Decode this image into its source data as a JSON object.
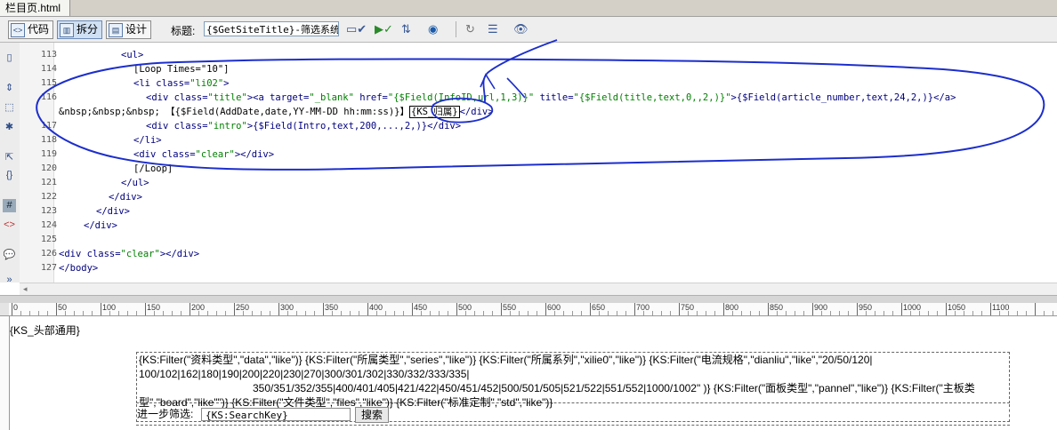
{
  "document": {
    "tab_title": "栏目页.html"
  },
  "toolbar": {
    "code_label": "代码",
    "split_label": "拆分",
    "design_label": "设计",
    "title_label": "标题:",
    "title_value": "{$GetSiteTitle}-筛选系统-"
  },
  "gutter": [
    "113",
    "114",
    "115",
    "116",
    "",
    "117",
    "118",
    "119",
    "120",
    "121",
    "122",
    "123",
    "124",
    "125",
    "126",
    "127"
  ],
  "code_lines": {
    "l113": "<ul>",
    "l114": "[Loop Times=\"10\"]",
    "l115a": "<li ",
    "l115b": "class=",
    "l115c": "\"li02\"",
    "l115d": ">",
    "l116a": "<div ",
    "l116b": "class=",
    "l116c": "\"title\"",
    "l116d": "><a ",
    "l116e": "target=",
    "l116f": "\"_blank\"",
    "l116g": " href=",
    "l116h": "\"{$Field(InfoID,url,1,3)}\"",
    "l116i": " title=",
    "l116j": "\"{$Field(title,text,0,,2,)}\"",
    "l116k": ">{$Field(article_number,text,24,2,)}</a>",
    "l116w_a": "&nbsp;&nbsp;&nbsp;",
    "l116w_b": "{$Field(AddDate,date,YY-MM-DD hh:mm:ss)}",
    "l116w_c": "{KS_归属}",
    "l116w_d": "</div>",
    "l117a": "<div ",
    "l117b": "class=",
    "l117c": "\"intro\"",
    "l117d": ">{$Field(Intro,text,200,...,2,)}</div>",
    "l118": "</li>",
    "l119a": "<div ",
    "l119b": "class=",
    "l119c": "\"clear\"",
    "l119d": "></div>",
    "l120": "[/Loop]",
    "l121": "</ul>",
    "l122": "</div>",
    "l123": "</div>",
    "l124": "</div>",
    "l125": "",
    "l126a": "<div ",
    "l126b": "class=",
    "l126c": "\"clear\"",
    "l126d": "></div>",
    "l127": "</body>"
  },
  "ruler": {
    "labels": [
      "0",
      "50",
      "100",
      "150",
      "200",
      "250",
      "300",
      "350",
      "400",
      "450",
      "500",
      "550",
      "600",
      "650",
      "700",
      "750",
      "800",
      "850",
      "900",
      "950",
      "1000",
      "1050",
      "1100"
    ]
  },
  "design": {
    "header_ks": "{KS_头部通用}",
    "filter_line1": "{KS:Filter(\"资料类型\",\"data\",\"like\")} {KS:Filter(\"所属类型\",\"series\",\"like\")} {KS:Filter(\"所属系列\",\"xilie0\",\"like\")} {KS:Filter(\"电流规格\",\"dianliu\",\"like\",\"20/50/120|",
    "filter_line2": "100/102|162|180|190|200|220|230|270|300/301/302|330/332/333/335|",
    "filter_line3": "350/351/352/355|400/401/405|421/422|450/451/452|500/501/505|521/522|551/552|1000/1002\" )} {KS:Filter(\"面板类型\",\"pannel\",\"like\")} {KS:Filter(\"主板类",
    "filter_line4": "型\",\"board\",\"like\"\")} {KS:Filter(\"文件类型\",\"files\",\"like\")} {KS:Filter(\"标准定制\",\"std\",\"like\")}",
    "search_label": "进一步筛选:",
    "search_value": "{KS:SearchKey}",
    "search_button": "搜索"
  }
}
